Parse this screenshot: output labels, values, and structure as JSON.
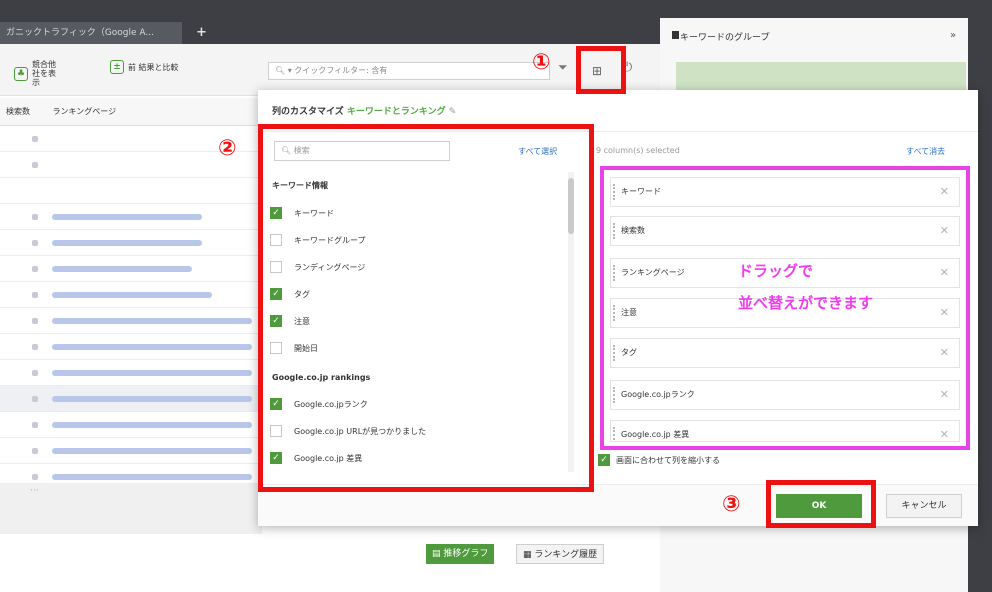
{
  "tab": {
    "title": "ガニックトラフィック（Google A...",
    "add": "+"
  },
  "toolbar": {
    "competitors_label": "競合他社を表示",
    "compare_label": "前 結果と比較",
    "quick_filter": "クイックフィルター: 含有"
  },
  "table": {
    "columns": [
      "検索数",
      "ランキングページ"
    ]
  },
  "side_panel": {
    "title": "キーワードのグループ",
    "chevron": "»"
  },
  "modal": {
    "title_prefix": "列のカスタマイズ",
    "title_accent": "キーワードとランキング",
    "search_placeholder": "検索",
    "select_all": "すべて選択",
    "groups": [
      {
        "name": "キーワード情報",
        "options": [
          {
            "label": "キーワード",
            "checked": true
          },
          {
            "label": "キーワードグループ",
            "checked": false
          },
          {
            "label": "ランディングページ",
            "checked": false
          },
          {
            "label": "タグ",
            "checked": true
          },
          {
            "label": "注意",
            "checked": true
          },
          {
            "label": "開始日",
            "checked": false
          }
        ]
      },
      {
        "name": "Google.co.jp rankings",
        "options": [
          {
            "label": "Google.co.jpランク",
            "checked": true
          },
          {
            "label": "Google.co.jp URLが見つかりました",
            "checked": false
          },
          {
            "label": "Google.co.jp 差異",
            "checked": true
          }
        ]
      }
    ],
    "selected_count": "9 column(s) selected",
    "clear_all": "すべて消去",
    "selected_columns": [
      "キーワード",
      "検索数",
      "ランキングページ",
      "注意",
      "タグ",
      "Google.co.jpランク",
      "Google.co.jp 差異"
    ],
    "fit_columns": "画面に合わせて列を縮小する",
    "ok": "OK",
    "cancel": "キャンセル"
  },
  "buttons": {
    "trend_graph": "推移グラフ",
    "ranking_history": "ランキング履歴"
  },
  "annotations": {
    "marker1": "①",
    "marker2": "②",
    "marker3": "③",
    "drag_note_line1": "ドラッグで",
    "drag_note_line2": "並べ替えができます"
  },
  "colors": {
    "annotation_red": "#ee1111",
    "annotation_magenta": "#e843e8",
    "accent_green": "#4f9a3c",
    "link_blue": "#2f6fc0"
  }
}
